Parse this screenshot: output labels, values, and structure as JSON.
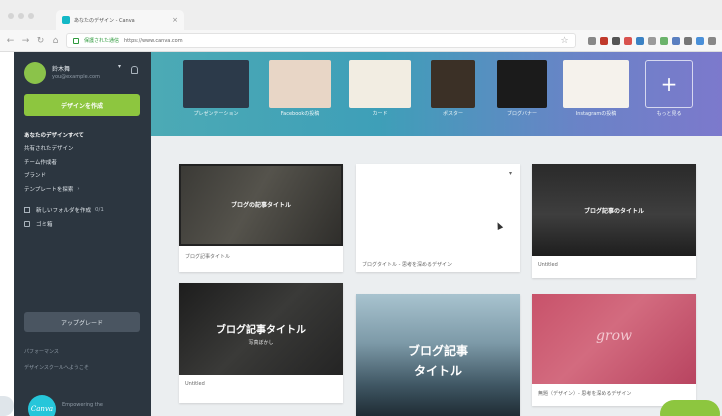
{
  "browser": {
    "tab_title": "あなたのデザイン - Canva",
    "tab_close": "×",
    "nav": {
      "back": "←",
      "forward": "→",
      "reload": "↻",
      "home": "⌂"
    },
    "secure_label": "保護された通信",
    "url": "https://www.canva.com",
    "star": "☆",
    "ext_colors": [
      "#888888",
      "#c0392b",
      "#555555",
      "#d9534f",
      "#3b82c4",
      "#9b9b9b",
      "#6bb36b",
      "#5a7fc0",
      "#777777",
      "#4a90d9",
      "#888888"
    ]
  },
  "sidebar": {
    "user_name": "鈴木舞",
    "user_email": "you@example.com",
    "user_caret": "▾",
    "create_button": "デザインを作成",
    "items": [
      {
        "label": "あなたのデザインすべて",
        "active": true
      },
      {
        "label": "共有されたデザイン"
      },
      {
        "label": "チーム作成者"
      },
      {
        "label": "ブランド"
      },
      {
        "label": "テンプレートを探索",
        "caret": "›"
      }
    ],
    "items2": [
      {
        "label": "新しいフォルダを作成",
        "count": "0/1"
      },
      {
        "label": "ゴミ箱"
      }
    ],
    "upgrade_button": "アップグレード",
    "link1": "パフォーマンス",
    "link2": "デザインスクールへようこそ",
    "logo_badge": "Canva",
    "logo_text": "Empowering the"
  },
  "banner": {
    "tiles": [
      {
        "label": "プレゼンテーション",
        "thumb": "#2c3a4a"
      },
      {
        "label": "Facebookの投稿",
        "thumb": "#e8d6c6"
      },
      {
        "label": "カード",
        "thumb": "#f2ede2"
      },
      {
        "label": "ポスター",
        "thumb": "#3b3026"
      },
      {
        "label": "ブログバナー",
        "thumb": "#1b1b1b"
      },
      {
        "label": "Instagramの投稿",
        "thumb": "#f5f2ec"
      },
      {
        "label": "もっと見る",
        "plus": "+"
      }
    ]
  },
  "cards": {
    "c1": {
      "overlay": "ブログの記事タイトル",
      "caption": "ブログ記事タイトル"
    },
    "c2": {
      "caption": "ブログタイトル - 思考を深めるデザイン",
      "more": "▾"
    },
    "c3": {
      "overlay": "ブログ記事のタイトル",
      "caption": "Untitled"
    },
    "c4": {
      "overlay": "ブログ記事タイトル",
      "sub": "写真ぼかし",
      "caption": "Untitled"
    },
    "c5": {
      "line1": "ブログ記事",
      "line2": "タイトル"
    },
    "c6": {
      "script": "grow",
      "caption": "無題（デザイン）- 思考を深めるデザイン"
    }
  }
}
